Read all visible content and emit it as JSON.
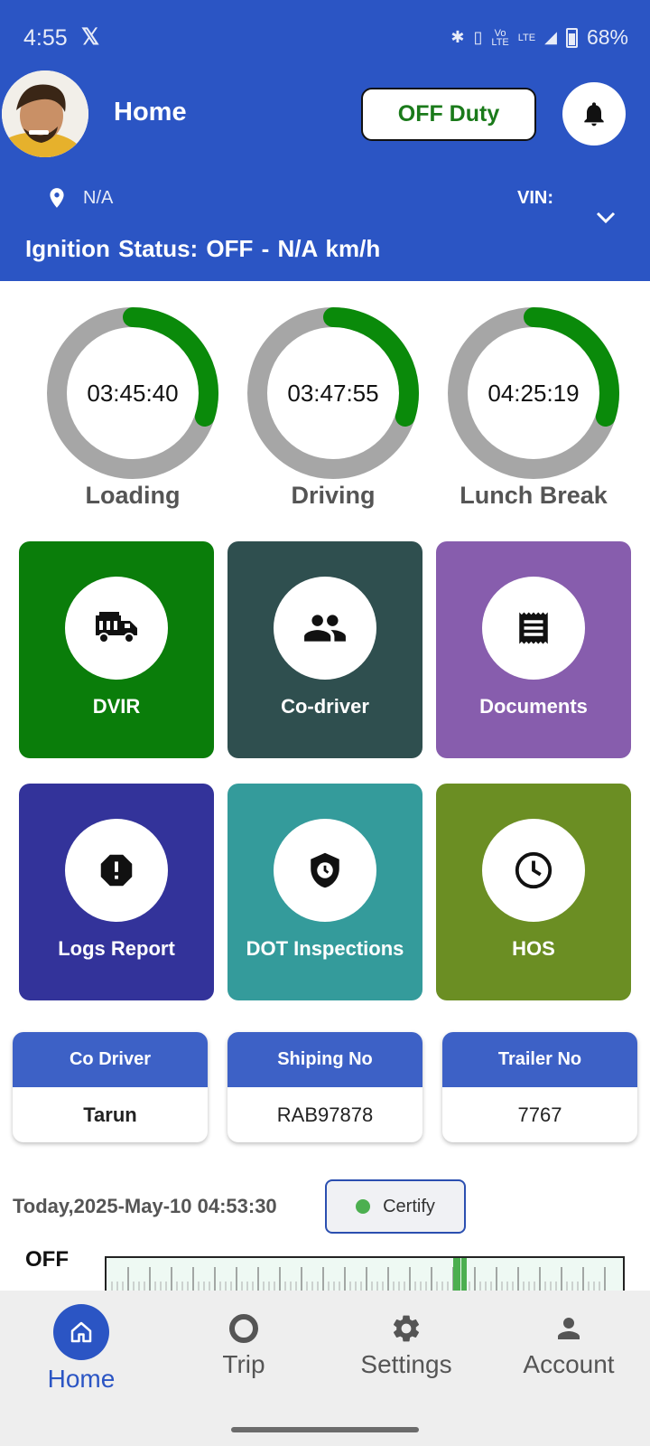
{
  "status_bar": {
    "time": "4:55",
    "battery": "68%",
    "network_small": "LTE"
  },
  "header": {
    "title": "Home",
    "duty_button": "OFF Duty",
    "location": "N/A",
    "vin_label": "VIN:",
    "ignition": "Ignition Status: OFF   -  N/A km/h"
  },
  "timers": [
    {
      "time": "03:45:40",
      "label": "Loading",
      "progress": 0.3
    },
    {
      "time": "03:47:55",
      "label": "Driving",
      "progress": 0.3
    },
    {
      "time": "04:25:19",
      "label": "Lunch Break",
      "progress": 0.3
    }
  ],
  "tiles": [
    {
      "label": "DVIR",
      "color": "#0a7d0a",
      "icon": "fire-truck-icon"
    },
    {
      "label": "Co-driver",
      "color": "#2f4f4f",
      "icon": "people-icon"
    },
    {
      "label": "Documents",
      "color": "#875dad",
      "icon": "receipt-icon"
    },
    {
      "label": "Logs Report",
      "color": "#33339a",
      "icon": "alert-octagon-icon"
    },
    {
      "label": "DOT Inspections",
      "color": "#349b9b",
      "icon": "shield-clock-icon"
    },
    {
      "label": "HOS",
      "color": "#6b8e23",
      "icon": "clock-icon"
    }
  ],
  "info_cards": [
    {
      "header": "Co Driver",
      "value": "Tarun"
    },
    {
      "header": "Shiping No",
      "value": "RAB97878"
    },
    {
      "header": "Trailer No",
      "value": "7767"
    }
  ],
  "log": {
    "date": "Today,2025-May-10 04:53:30",
    "certify": "Certify",
    "status_label": "OFF"
  },
  "nav": [
    {
      "label": "Home",
      "active": true
    },
    {
      "label": "Trip",
      "active": false
    },
    {
      "label": "Settings",
      "active": false
    },
    {
      "label": "Account",
      "active": false
    }
  ],
  "colors": {
    "primary": "#2b55c4",
    "ring_progress": "#0a8a0a",
    "ring_track": "#a6a6a6"
  }
}
